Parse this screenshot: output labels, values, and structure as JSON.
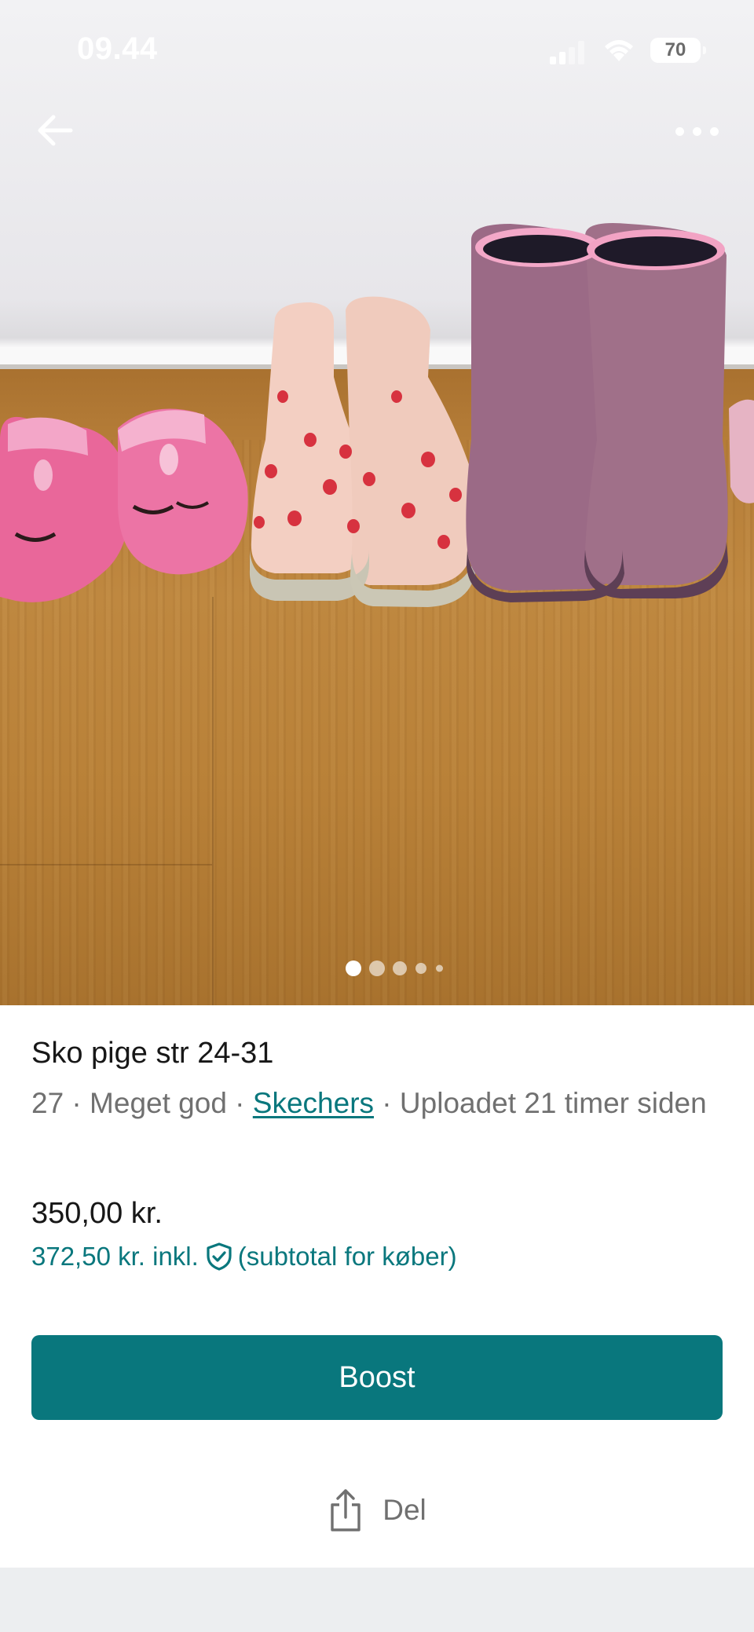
{
  "status_bar": {
    "time": "09.44",
    "battery": "70"
  },
  "photo": {
    "image_count": 5,
    "active_index": 0
  },
  "item": {
    "title": "Sko pige str 24-31",
    "size": "27",
    "condition": "Meget god",
    "brand": "Skechers",
    "uploaded": "Uploadet 21 timer siden",
    "separator": " · ",
    "price": "350,00 kr.",
    "price_incl": "372,50 kr. inkl.",
    "price_incl_note": "(subtotal for køber)"
  },
  "actions": {
    "boost_label": "Boost",
    "share_label": "Del"
  },
  "icons": {
    "back": "arrow-left-icon",
    "more": "more-horizontal-icon",
    "shield": "shield-check-icon",
    "share": "share-icon"
  },
  "colors": {
    "accent": "#09777d",
    "text_primary": "#171717",
    "text_secondary": "#707070",
    "footer_band": "#eceef0"
  }
}
